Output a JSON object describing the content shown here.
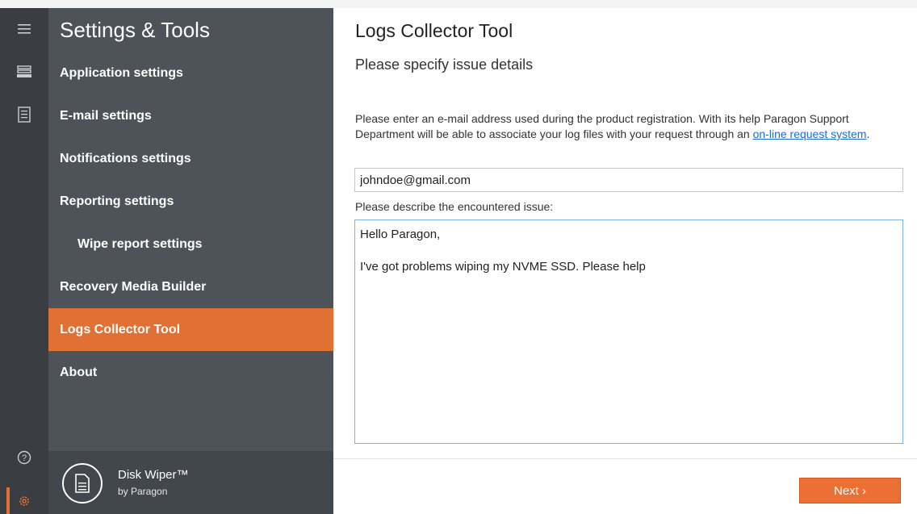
{
  "sidebar": {
    "title": "Settings & Tools",
    "items": [
      {
        "label": "Application settings"
      },
      {
        "label": "E-mail settings"
      },
      {
        "label": "Notifications settings"
      },
      {
        "label": "Reporting settings"
      },
      {
        "label": "Wipe report settings"
      },
      {
        "label": "Recovery Media Builder"
      },
      {
        "label": "Logs Collector Tool"
      },
      {
        "label": "About"
      }
    ],
    "active_item": "Logs Collector Tool",
    "brand": {
      "name": "Disk Wiper™",
      "by": "by Paragon"
    }
  },
  "rail": {
    "icons": [
      "menu-icon",
      "drive-icon",
      "report-icon",
      "help-icon",
      "gear-icon"
    ]
  },
  "main": {
    "title": "Logs Collector Tool",
    "subtitle": "Please specify issue details",
    "description": "Please enter an e-mail address used during the product registration. With its help Paragon Support Department will be able to associate your log files with your request through an ",
    "description_link": "on-line request system",
    "description_end": ".",
    "email_value": "johndoe@gmail.com",
    "issue_label": "Please describe the encountered issue:",
    "issue_value": "Hello Paragon,\n\nI've got problems wiping my NVME SSD. Please help",
    "next_label": "Next ›"
  },
  "colors": {
    "accent": "#e07033",
    "sidebar": "#4d5359",
    "rail": "#3a3e43",
    "link": "#1a6fd1"
  }
}
